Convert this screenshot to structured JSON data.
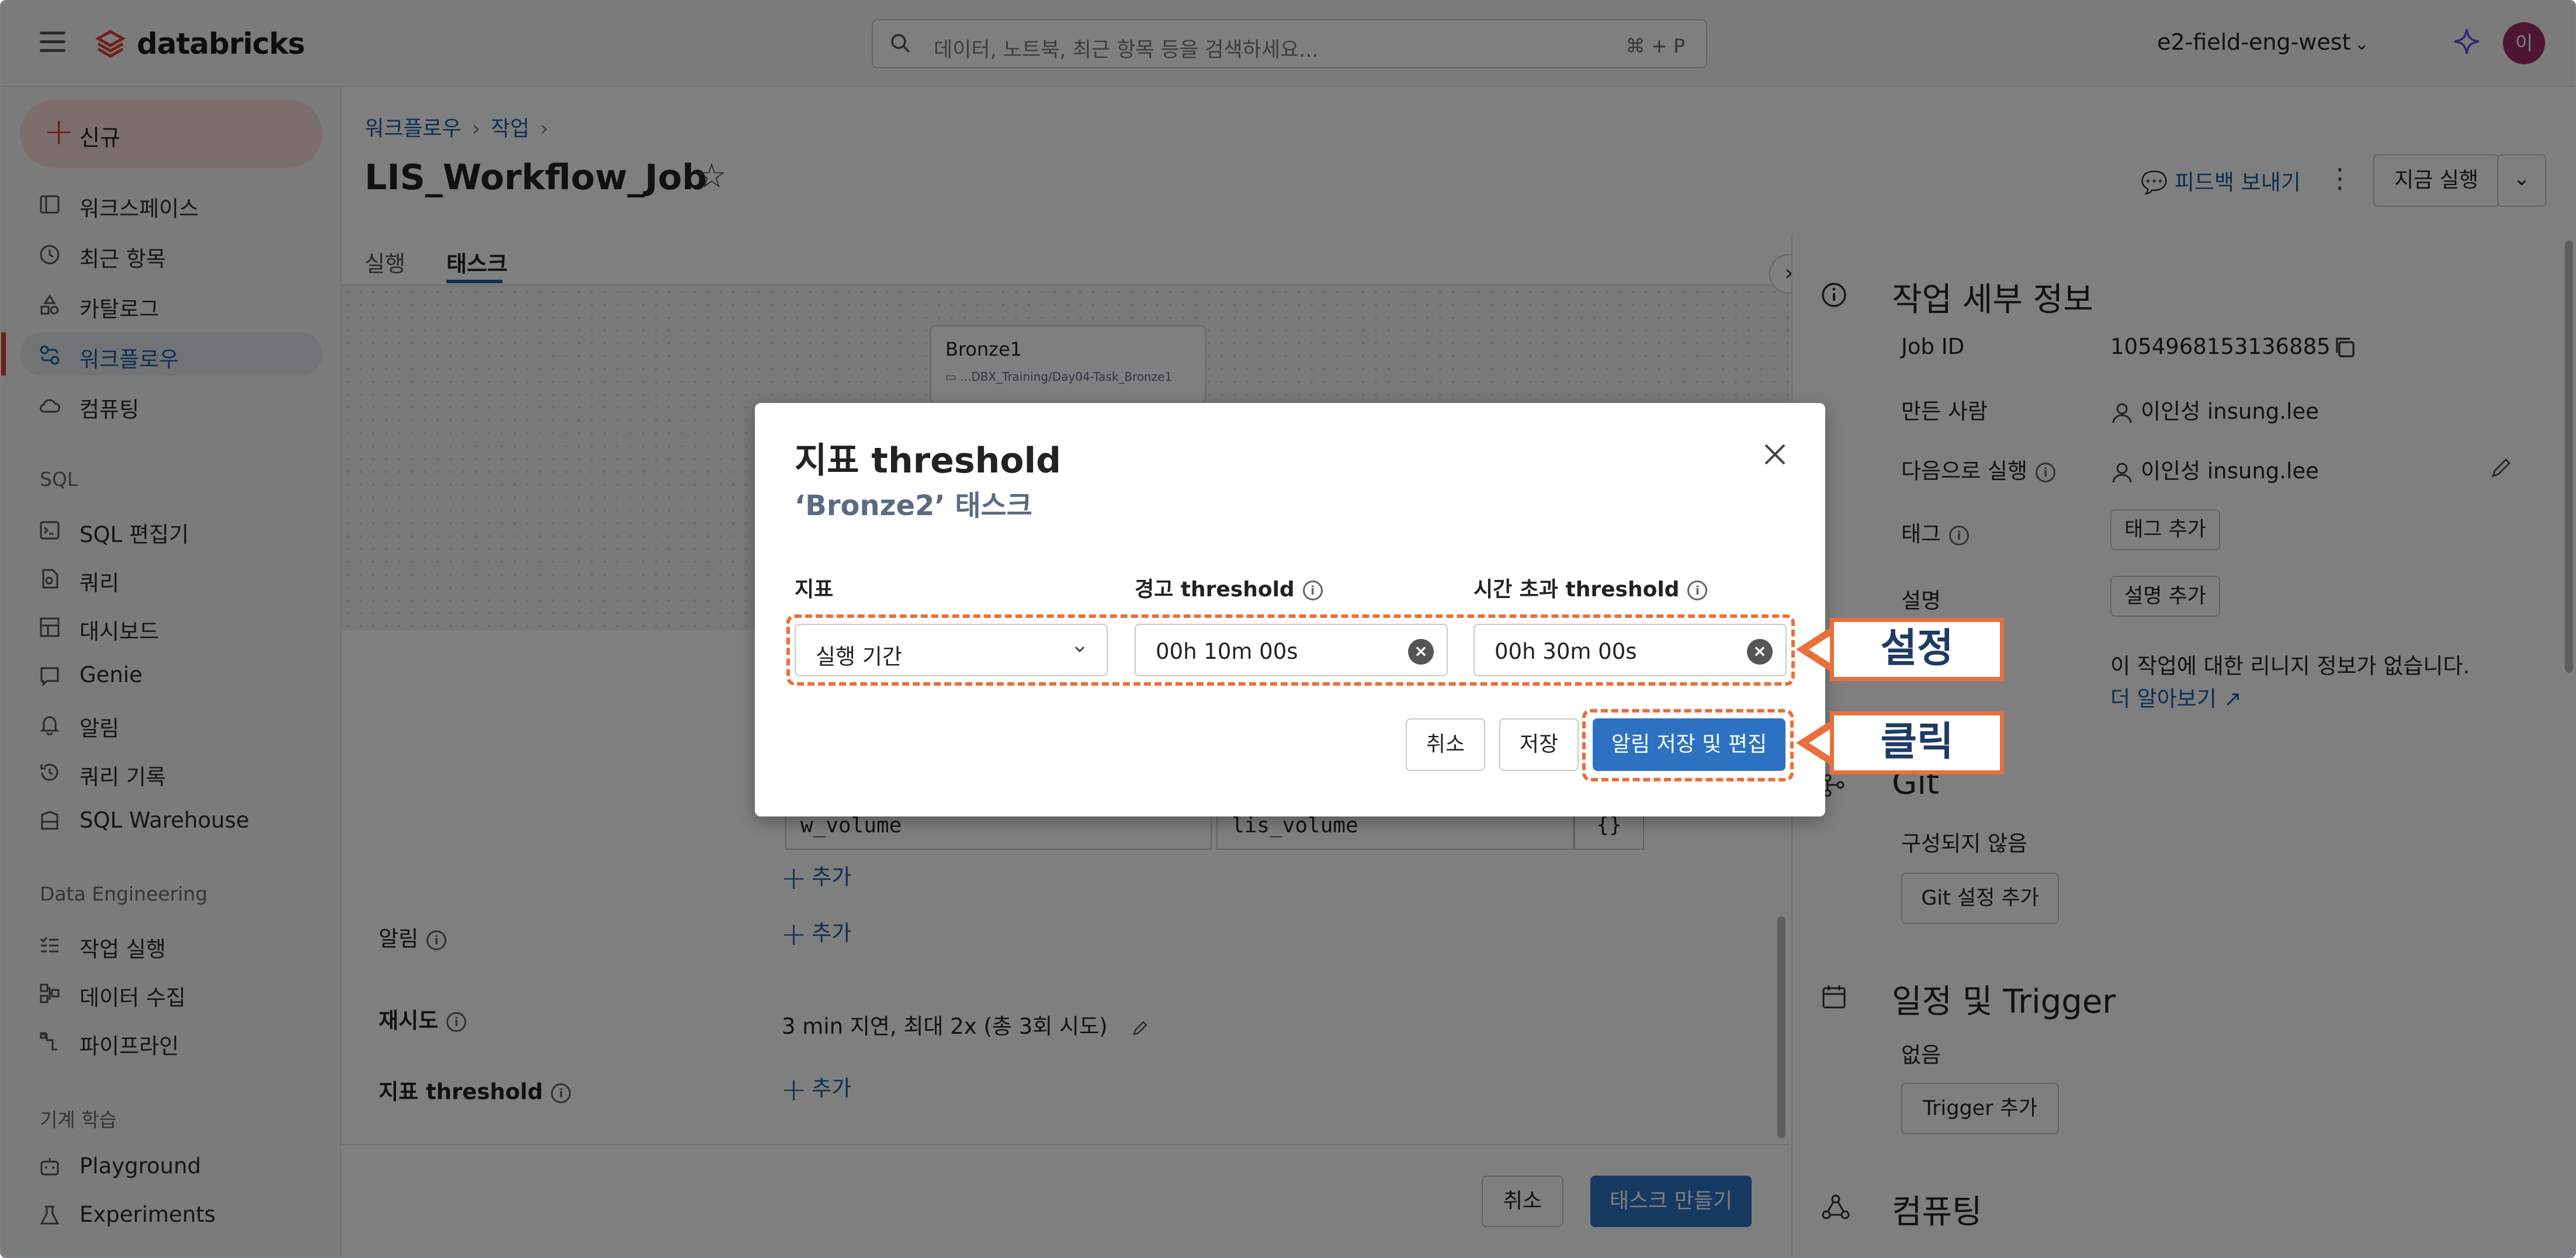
{
  "app": {
    "brand": "databricks",
    "search_placeholder": "데이터, 노트북, 최근 항목 등을 검색하세요...",
    "search_shortcut": "⌘ + P",
    "workspace": "e2-field-eng-west",
    "avatar_initial": "이"
  },
  "sidebar": {
    "new_label": "신규",
    "items": [
      {
        "label": "워크스페이스",
        "icon": "workspace-icon"
      },
      {
        "label": "최근 항목",
        "icon": "clock-icon"
      },
      {
        "label": "카탈로그",
        "icon": "catalog-icon"
      },
      {
        "label": "워크플로우",
        "icon": "workflow-icon",
        "active": true
      },
      {
        "label": "컴퓨팅",
        "icon": "cloud-icon"
      }
    ],
    "sql_section": "SQL",
    "sql_items": [
      {
        "label": "SQL 편집기",
        "icon": "sql-editor-icon"
      },
      {
        "label": "쿼리",
        "icon": "query-icon"
      },
      {
        "label": "대시보드",
        "icon": "dashboard-icon"
      },
      {
        "label": "Genie",
        "icon": "genie-icon"
      },
      {
        "label": "알림",
        "icon": "bell-icon"
      },
      {
        "label": "쿼리 기록",
        "icon": "history-icon"
      },
      {
        "label": "SQL Warehouse",
        "icon": "warehouse-icon"
      }
    ],
    "de_section": "Data Engineering",
    "de_items": [
      {
        "label": "작업 실행",
        "icon": "job-runs-icon"
      },
      {
        "label": "데이터 수집",
        "icon": "ingest-icon"
      },
      {
        "label": "파이프라인",
        "icon": "pipeline-icon"
      }
    ],
    "ml_section": "기계 학습",
    "ml_items": [
      {
        "label": "Playground",
        "icon": "playground-icon"
      },
      {
        "label": "Experiments",
        "icon": "experiments-icon"
      }
    ]
  },
  "main": {
    "breadcrumb": [
      "워크플로우",
      "작업"
    ],
    "title": "LIS_Workflow_Job",
    "tabs": [
      "실행",
      "태스크"
    ],
    "selected_tab": "태스크",
    "node": {
      "name": "Bronze1",
      "path": "...DBX_Training/Day04-Task_Bronze1"
    },
    "param_key": "w_volume",
    "param_value": "lis_volume",
    "param_braces": "{}",
    "add_label": "추가",
    "notifications_label": "알림",
    "retries_label": "재시도",
    "retries_value": "3 min 지연, 최대 2x (총 3회 시도)",
    "threshold_label": "지표 threshold",
    "cancel_label": "취소",
    "create_label": "태스크 만들기"
  },
  "header_actions": {
    "feedback": "피드백 보내기",
    "run_now": "지금 실행"
  },
  "details": {
    "heading": "작업 세부 정보",
    "job_id_label": "Job ID",
    "job_id": "1054968153136885",
    "creator_label": "만든 사람",
    "creator": "이인성 insung.lee",
    "run_as_label": "다음으로 실행",
    "run_as": "이인성 insung.lee",
    "tags_label": "태그",
    "tags_button": "태그 추가",
    "desc_label": "설명",
    "desc_button": "설명 추가",
    "lineage_text": "이 작업에 대한 리니지 정보가 없습니다.",
    "learn_more": "더 알아보기",
    "git_heading": "Git",
    "git_status": "구성되지 않음",
    "git_button": "Git 설정 추가",
    "schedule_heading": "일정 및 Trigger",
    "schedule_value": "없음",
    "trigger_button": "Trigger 추가",
    "compute_heading": "컴퓨팅"
  },
  "modal": {
    "title": "지표 threshold",
    "subtitle": "‘Bronze2’ 태스크",
    "col_metric": "지표",
    "col_warning": "경고 threshold",
    "col_timeout": "시간 초과 threshold",
    "metric_value": "실행 기간",
    "warning_value": "00h 10m 00s",
    "timeout_value": "00h 30m 00s",
    "cancel": "취소",
    "save": "저장",
    "save_edit": "알림 저장 및 편집"
  },
  "callouts": {
    "settings": "설정",
    "click": "클릭"
  },
  "colors": {
    "accent": "#2d72c2",
    "brand": "#e0402f",
    "annotation": "#e9703a",
    "link": "#1d5ea6"
  }
}
